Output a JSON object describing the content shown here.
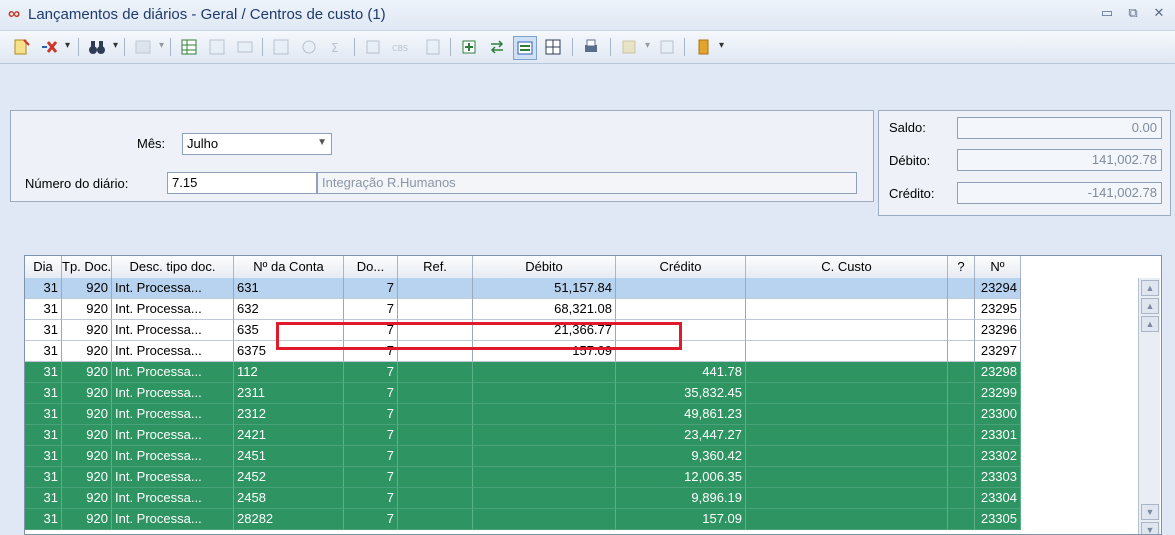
{
  "window": {
    "title": "Lançamentos de diários - Geral / Centros de custo (1)",
    "icon": "infinity-icon",
    "controls": [
      "minimize-icon",
      "restore-icon",
      "close-icon"
    ]
  },
  "toolbar": {
    "icons": [
      "new-entry-icon",
      "delete-x-icon",
      "find-binoculars-icon",
      "filter-icon",
      "table-icon",
      "table-export-icon",
      "columns-icon",
      "grid-icon",
      "tree-icon",
      "sum-icon",
      "wizard-icon",
      "cbs-icon",
      "document-icon",
      "insert-rows-icon",
      "swap-icon",
      "distribute-icon",
      "grid-view-icon",
      "print-icon",
      "book-icon",
      "flag-icon"
    ],
    "active_icon": "distribute-icon"
  },
  "form": {
    "mes_label": "Mês:",
    "mes_value": "Julho",
    "numero_label": "Número do diário:",
    "numero_value": "7.15",
    "descricao": "Integração R.Humanos",
    "saldo_label": "Saldo:",
    "saldo_value": "0.00",
    "debito_label": "Débito:",
    "debito_value": "141,002.78",
    "credito_label": "Crédito:",
    "credito_value": "-141,002.78"
  },
  "grid": {
    "columns": [
      "Dia",
      "Tp. Doc.",
      "Desc. tipo doc.",
      "Nº da Conta",
      "Do...",
      "Ref.",
      "Débito",
      "Crédito",
      "C. Custo",
      "?",
      "Nº"
    ],
    "rows": [
      {
        "dia": "31",
        "tp": "920",
        "desc": "Int. Processa...",
        "conta": "631",
        "do": "7",
        "ref": "",
        "debito": "51,157.84",
        "credito": "",
        "ccusto": "",
        "q": "",
        "n": "23294",
        "style": "sel"
      },
      {
        "dia": "31",
        "tp": "920",
        "desc": "Int. Processa...",
        "conta": "632",
        "do": "7",
        "ref": "",
        "debito": "68,321.08",
        "credito": "",
        "ccusto": "",
        "q": "",
        "n": "23295",
        "style": "white"
      },
      {
        "dia": "31",
        "tp": "920",
        "desc": "Int. Processa...",
        "conta": "635",
        "do": "7",
        "ref": "",
        "debito": "21,366.77",
        "credito": "",
        "ccusto": "",
        "q": "",
        "n": "23296",
        "style": "white"
      },
      {
        "dia": "31",
        "tp": "920",
        "desc": "Int. Processa...",
        "conta": "6375",
        "do": "7",
        "ref": "",
        "debito": "157.09",
        "credito": "",
        "ccusto": "",
        "q": "",
        "n": "23297",
        "style": "white"
      },
      {
        "dia": "31",
        "tp": "920",
        "desc": "Int. Processa...",
        "conta": "112",
        "do": "7",
        "ref": "",
        "debito": "",
        "credito": "441.78",
        "ccusto": "",
        "q": "",
        "n": "23298",
        "style": "green"
      },
      {
        "dia": "31",
        "tp": "920",
        "desc": "Int. Processa...",
        "conta": "2311",
        "do": "7",
        "ref": "",
        "debito": "",
        "credito": "35,832.45",
        "ccusto": "",
        "q": "",
        "n": "23299",
        "style": "green"
      },
      {
        "dia": "31",
        "tp": "920",
        "desc": "Int. Processa...",
        "conta": "2312",
        "do": "7",
        "ref": "",
        "debito": "",
        "credito": "49,861.23",
        "ccusto": "",
        "q": "",
        "n": "23300",
        "style": "green"
      },
      {
        "dia": "31",
        "tp": "920",
        "desc": "Int. Processa...",
        "conta": "2421",
        "do": "7",
        "ref": "",
        "debito": "",
        "credito": "23,447.27",
        "ccusto": "",
        "q": "",
        "n": "23301",
        "style": "green"
      },
      {
        "dia": "31",
        "tp": "920",
        "desc": "Int. Processa...",
        "conta": "2451",
        "do": "7",
        "ref": "",
        "debito": "",
        "credito": "9,360.42",
        "ccusto": "",
        "q": "",
        "n": "23302",
        "style": "green"
      },
      {
        "dia": "31",
        "tp": "920",
        "desc": "Int. Processa...",
        "conta": "2452",
        "do": "7",
        "ref": "",
        "debito": "",
        "credito": "12,006.35",
        "ccusto": "",
        "q": "",
        "n": "23303",
        "style": "green"
      },
      {
        "dia": "31",
        "tp": "920",
        "desc": "Int. Processa...",
        "conta": "2458",
        "do": "7",
        "ref": "",
        "debito": "",
        "credito": "9,896.19",
        "ccusto": "",
        "q": "",
        "n": "23304",
        "style": "green"
      },
      {
        "dia": "31",
        "tp": "920",
        "desc": "Int. Processa...",
        "conta": "28282",
        "do": "7",
        "ref": "",
        "debito": "",
        "credito": "157.09",
        "ccusto": "",
        "q": "",
        "n": "23305",
        "style": "green"
      }
    ]
  }
}
